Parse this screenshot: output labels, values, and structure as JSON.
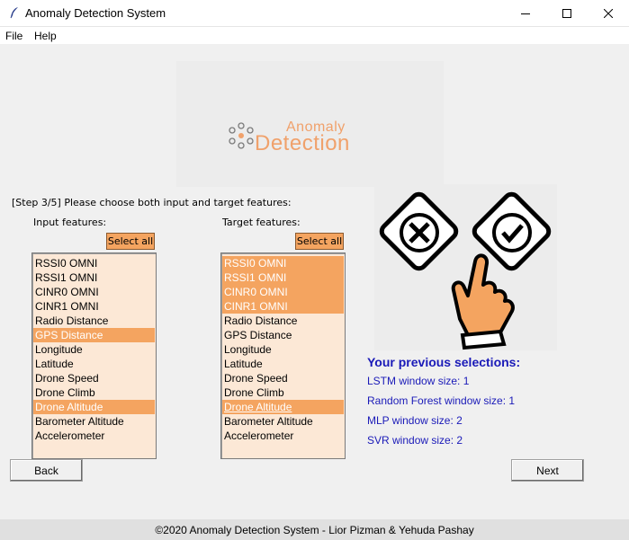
{
  "window": {
    "title": "Anomaly Detection System",
    "icon": "feather-icon"
  },
  "menu": [
    "File",
    "Help"
  ],
  "logo": {
    "word1": "Anomaly",
    "word2": "Detection",
    "color": "#f0a16b"
  },
  "step_text": "[Step 3/5] Please choose both input and target features:",
  "input": {
    "label": "Input features:",
    "select_all": "Select all",
    "items": [
      {
        "label": "RSSI0 OMNI",
        "selected": false
      },
      {
        "label": "RSSI1 OMNI",
        "selected": false
      },
      {
        "label": "CINR0 OMNI",
        "selected": false
      },
      {
        "label": "CINR1 OMNI",
        "selected": false
      },
      {
        "label": "Radio Distance",
        "selected": false
      },
      {
        "label": "GPS Distance",
        "selected": true
      },
      {
        "label": "Longitude",
        "selected": false
      },
      {
        "label": "Latitude",
        "selected": false
      },
      {
        "label": "Drone Speed",
        "selected": false
      },
      {
        "label": "Drone Climb",
        "selected": false
      },
      {
        "label": "Drone Altitude",
        "selected": true
      },
      {
        "label": "Barometer Altitude",
        "selected": false
      },
      {
        "label": "Accelerometer",
        "selected": false
      }
    ]
  },
  "target": {
    "label": "Target features:",
    "select_all": "Select all",
    "items": [
      {
        "label": "RSSI0 OMNI",
        "selected": true
      },
      {
        "label": "RSSI1 OMNI",
        "selected": true
      },
      {
        "label": "CINR0 OMNI",
        "selected": true
      },
      {
        "label": "CINR1 OMNI",
        "selected": true
      },
      {
        "label": "Radio Distance",
        "selected": false
      },
      {
        "label": "GPS Distance",
        "selected": false
      },
      {
        "label": "Longitude",
        "selected": false
      },
      {
        "label": "Latitude",
        "selected": false
      },
      {
        "label": "Drone Speed",
        "selected": false
      },
      {
        "label": "Drone Climb",
        "selected": false
      },
      {
        "label": "Drone Altitude",
        "selected": true,
        "active": true
      },
      {
        "label": "Barometer Altitude",
        "selected": false
      },
      {
        "label": "Accelerometer",
        "selected": false
      }
    ]
  },
  "previous": {
    "title": "Your previous selections:",
    "items": [
      "LSTM window size: 1",
      "Random Forest window size: 1",
      "MLP window size: 2",
      "SVR window size: 2"
    ]
  },
  "buttons": {
    "back": "Back",
    "next": "Next"
  },
  "footer": "©2020 Anomaly Detection System - Lior Pizman & Yehuda Pashay",
  "colors": {
    "accent": "#f4a460",
    "list_bg": "#fce8d6",
    "prev_text": "#1a1ab8"
  }
}
